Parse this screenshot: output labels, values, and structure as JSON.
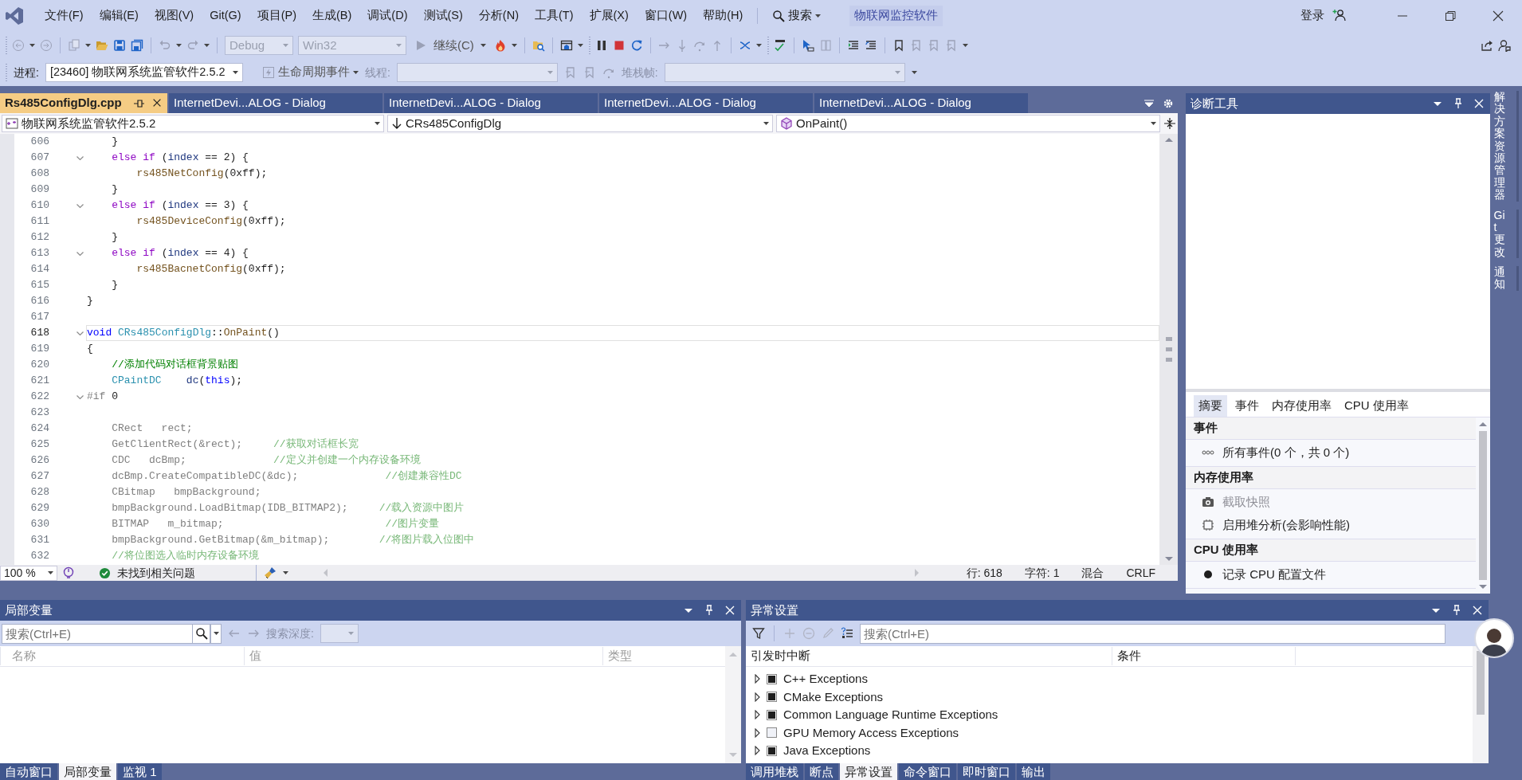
{
  "menu": [
    "文件(F)",
    "编辑(E)",
    "视图(V)",
    "Git(G)",
    "项目(P)",
    "生成(B)",
    "调试(D)",
    "测试(S)",
    "分析(N)",
    "工具(T)",
    "扩展(X)",
    "窗口(W)",
    "帮助(H)"
  ],
  "search": {
    "label": "搜索"
  },
  "solution_title": "物联网监控软件",
  "sign_in": "登录",
  "toolbar": {
    "configuration": {
      "value": "Debug",
      "disabled": true
    },
    "platform": {
      "value": "Win32",
      "disabled": true
    },
    "continue": {
      "label": "继续(C)"
    }
  },
  "debug_location": {
    "process_label": "进程:",
    "process": "[23460] 物联网系统监管软件2.5.2",
    "lifecycle": "生命周期事件",
    "thread_label": "线程:",
    "stack_label": "堆栈帧:"
  },
  "editor": {
    "tabs": [
      {
        "label": "Rs485ConfigDlg.cpp",
        "selected": true
      },
      {
        "label": "InternetDevi...ALOG - Dialog",
        "selected": false
      },
      {
        "label": "InternetDevi...ALOG - Dialog",
        "selected": false
      },
      {
        "label": "InternetDevi...ALOG - Dialog",
        "selected": false
      },
      {
        "label": "InternetDevi...ALOG - Dialog",
        "selected": false
      }
    ],
    "navigation": {
      "project": "物联网系统监管软件2.5.2",
      "scope": "CRs485ConfigDlg",
      "member": "OnPaint()"
    },
    "lines": [
      {
        "number": "606",
        "fold": false,
        "current": false,
        "tokens": [
          {
            "kind": "plain",
            "text": "    }"
          }
        ]
      },
      {
        "number": "607",
        "fold": true,
        "current": false,
        "tokens": [
          {
            "kind": "ctrl",
            "text": "    else if"
          },
          {
            "kind": "plain",
            "text": " ("
          },
          {
            "kind": "param",
            "text": "index"
          },
          {
            "kind": "plain",
            "text": " == 2) {"
          }
        ]
      },
      {
        "number": "608",
        "fold": false,
        "current": false,
        "tokens": [
          {
            "kind": "fn",
            "text": "        rs485NetConfig"
          },
          {
            "kind": "plain",
            "text": "(0xff);"
          }
        ]
      },
      {
        "number": "609",
        "fold": false,
        "current": false,
        "tokens": [
          {
            "kind": "plain",
            "text": "    }"
          }
        ]
      },
      {
        "number": "610",
        "fold": true,
        "current": false,
        "tokens": [
          {
            "kind": "ctrl",
            "text": "    else if"
          },
          {
            "kind": "plain",
            "text": " ("
          },
          {
            "kind": "param",
            "text": "index"
          },
          {
            "kind": "plain",
            "text": " == 3) {"
          }
        ]
      },
      {
        "number": "611",
        "fold": false,
        "current": false,
        "tokens": [
          {
            "kind": "fn",
            "text": "        rs485DeviceConfig"
          },
          {
            "kind": "plain",
            "text": "(0xff);"
          }
        ]
      },
      {
        "number": "612",
        "fold": false,
        "current": false,
        "tokens": [
          {
            "kind": "plain",
            "text": "    }"
          }
        ]
      },
      {
        "number": "613",
        "fold": true,
        "current": false,
        "tokens": [
          {
            "kind": "ctrl",
            "text": "    else if"
          },
          {
            "kind": "plain",
            "text": " ("
          },
          {
            "kind": "param",
            "text": "index"
          },
          {
            "kind": "plain",
            "text": " == 4) {"
          }
        ]
      },
      {
        "number": "614",
        "fold": false,
        "current": false,
        "tokens": [
          {
            "kind": "fn",
            "text": "        rs485BacnetConfig"
          },
          {
            "kind": "plain",
            "text": "(0xff);"
          }
        ]
      },
      {
        "number": "615",
        "fold": false,
        "current": false,
        "tokens": [
          {
            "kind": "plain",
            "text": "    }"
          }
        ]
      },
      {
        "number": "616",
        "fold": false,
        "current": false,
        "tokens": [
          {
            "kind": "plain",
            "text": "}"
          }
        ]
      },
      {
        "number": "617",
        "fold": false,
        "current": false
      },
      {
        "number": "618",
        "fold": true,
        "current": true,
        "tokens": [
          {
            "kind": "kw",
            "text": "void"
          },
          {
            "kind": "type",
            "text": " CRs485ConfigDlg"
          },
          {
            "kind": "plain",
            "text": "::"
          },
          {
            "kind": "fn",
            "text": "OnPaint"
          },
          {
            "kind": "plain",
            "text": "()"
          }
        ]
      },
      {
        "number": "619",
        "fold": false,
        "current": false,
        "tokens": [
          {
            "kind": "plain",
            "text": "{"
          }
        ]
      },
      {
        "number": "620",
        "fold": false,
        "current": false,
        "tokens": [
          {
            "kind": "comment",
            "text": "    //添加代码对话框背景贴图"
          }
        ]
      },
      {
        "number": "621",
        "fold": false,
        "current": false,
        "tokens": [
          {
            "kind": "type",
            "text": "    CPaintDC"
          },
          {
            "kind": "local",
            "text": "    dc"
          },
          {
            "kind": "plain",
            "text": "("
          },
          {
            "kind": "kw",
            "text": "this"
          },
          {
            "kind": "plain",
            "text": ");"
          }
        ]
      },
      {
        "number": "622",
        "fold": true,
        "current": false,
        "tokens": [
          {
            "kind": "pre",
            "text": "#if"
          },
          {
            "kind": "plain",
            "text": " 0"
          }
        ]
      },
      {
        "number": "623",
        "fold": false,
        "current": false
      },
      {
        "number": "624",
        "fold": false,
        "current": false,
        "tokens": [
          {
            "kind": "inactive",
            "text": "    CRect   rect;"
          }
        ]
      },
      {
        "number": "625",
        "fold": false,
        "current": false,
        "tokens": [
          {
            "kind": "inactive",
            "text": "    GetClientRect(&rect);"
          },
          {
            "kind": "inactive-comment",
            "text": "     //获取对话框长宽"
          }
        ]
      },
      {
        "number": "626",
        "fold": false,
        "current": false,
        "tokens": [
          {
            "kind": "inactive",
            "text": "    CDC   dcBmp;"
          },
          {
            "kind": "inactive-comment",
            "text": "              //定义并创建一个内存设备环境"
          }
        ]
      },
      {
        "number": "627",
        "fold": false,
        "current": false,
        "tokens": [
          {
            "kind": "inactive",
            "text": "    dcBmp.CreateCompatibleDC(&dc);"
          },
          {
            "kind": "inactive-comment",
            "text": "              //创建兼容性DC"
          }
        ]
      },
      {
        "number": "628",
        "fold": false,
        "current": false,
        "tokens": [
          {
            "kind": "inactive",
            "text": "    CBitmap   bmpBackground;"
          }
        ]
      },
      {
        "number": "629",
        "fold": false,
        "current": false,
        "tokens": [
          {
            "kind": "inactive",
            "text": "    bmpBackground.LoadBitmap(IDB_BITMAP2);"
          },
          {
            "kind": "inactive-comment",
            "text": "     //载入资源中图片"
          }
        ]
      },
      {
        "number": "630",
        "fold": false,
        "current": false,
        "tokens": [
          {
            "kind": "inactive",
            "text": "    BITMAP   m_bitmap;"
          },
          {
            "kind": "inactive-comment",
            "text": "                          //图片变量"
          }
        ]
      },
      {
        "number": "631",
        "fold": false,
        "current": false,
        "tokens": [
          {
            "kind": "inactive",
            "text": "    bmpBackground.GetBitmap(&m_bitmap);"
          },
          {
            "kind": "inactive-comment",
            "text": "        //将图片载入位图中"
          }
        ]
      },
      {
        "number": "632",
        "fold": false,
        "current": false,
        "tokens": [
          {
            "kind": "inactive-comment",
            "text": "    //将位图选入临时内存设备环境"
          }
        ]
      }
    ],
    "status": {
      "zoom": "100 %",
      "issues": "未找到相关问题",
      "line": "行: 618",
      "char": "字符: 1",
      "encoding": "混合",
      "line_ending": "CRLF"
    }
  },
  "diagnostics": {
    "title": "诊断工具",
    "tabs": [
      {
        "label": "摘要",
        "selected": true
      },
      {
        "label": "事件",
        "selected": false
      },
      {
        "label": "内存使用率",
        "selected": false
      },
      {
        "label": "CPU 使用率",
        "selected": false
      }
    ],
    "sections": [
      {
        "title": "事件",
        "items": [
          {
            "kind": "events",
            "label": "所有事件(0 个，共 0 个)",
            "disabled": false
          }
        ]
      },
      {
        "title": "内存使用率",
        "items": [
          {
            "kind": "snapshot",
            "label": "截取快照",
            "disabled": true
          },
          {
            "kind": "heap",
            "label": "启用堆分析(会影响性能)",
            "disabled": false
          }
        ]
      },
      {
        "title": "CPU 使用率",
        "items": [
          {
            "kind": "record",
            "label": "记录 CPU 配置文件",
            "disabled": false
          }
        ]
      }
    ]
  },
  "side_tabs": [
    "解决方案资源管理器",
    "Git 更改",
    "通知"
  ],
  "locals": {
    "title": "局部变量",
    "search": {
      "placeholder": "搜索(Ctrl+E)"
    },
    "depth_label": "搜索深度:",
    "columns": [
      "名称",
      "值",
      "类型"
    ],
    "tabs": [
      {
        "label": "自动窗口",
        "selected": false
      },
      {
        "label": "局部变量",
        "selected": true
      },
      {
        "label": "监视 1",
        "selected": false
      }
    ]
  },
  "exceptions": {
    "title": "异常设置",
    "search": {
      "placeholder": "搜索(Ctrl+E)"
    },
    "columns": [
      "引发时中断",
      "条件"
    ],
    "rows": [
      {
        "label": "C++ Exceptions",
        "checked": true
      },
      {
        "label": "CMake Exceptions",
        "checked": true
      },
      {
        "label": "Common Language Runtime Exceptions",
        "checked": true
      },
      {
        "label": "GPU Memory Access Exceptions",
        "checked": false
      },
      {
        "label": "Java Exceptions",
        "checked": true
      }
    ],
    "tabs": [
      {
        "label": "调用堆栈",
        "selected": false
      },
      {
        "label": "断点",
        "selected": false
      },
      {
        "label": "异常设置",
        "selected": true
      },
      {
        "label": "命令窗口",
        "selected": false
      },
      {
        "label": "即时窗口",
        "selected": false
      },
      {
        "label": "输出",
        "selected": false
      }
    ]
  }
}
